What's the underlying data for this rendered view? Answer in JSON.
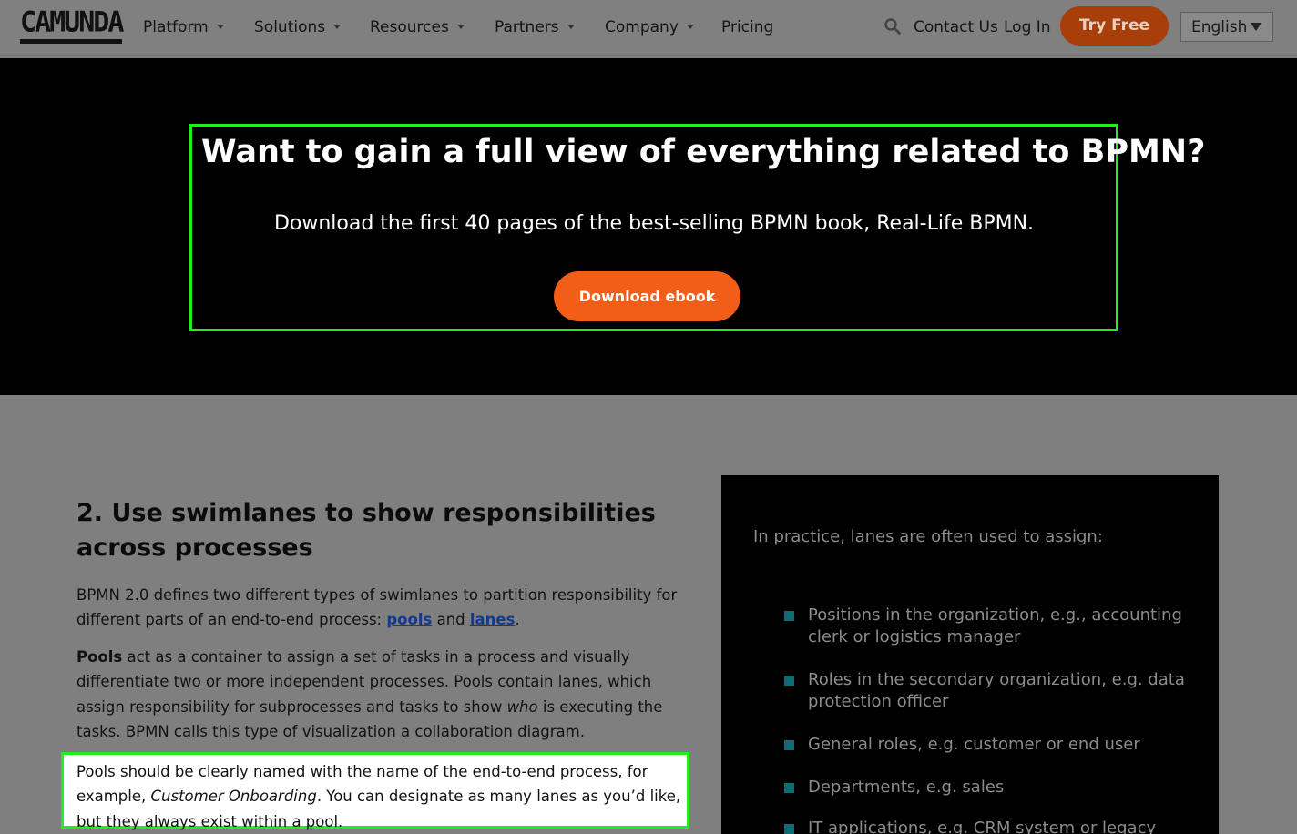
{
  "nav": {
    "logo": "CAMUNDA",
    "items": [
      {
        "label": "Platform",
        "dropdown": true
      },
      {
        "label": "Solutions",
        "dropdown": true
      },
      {
        "label": "Resources",
        "dropdown": true
      },
      {
        "label": "Partners",
        "dropdown": true
      },
      {
        "label": "Company",
        "dropdown": true
      },
      {
        "label": "Pricing",
        "dropdown": false
      }
    ],
    "contact": "Contact Us",
    "login": "Log In",
    "try_free": "Try Free",
    "language": "English"
  },
  "hero": {
    "title": "Want to gain a full view of everything related to BPMN?",
    "subtitle": "Download the first 40 pages of the best-selling BPMN book, Real-Life BPMN.",
    "button": "Download ebook"
  },
  "content": {
    "title": "2. Use swimlanes to show responsibilities across processes",
    "p1_text": "BPMN 2.0 defines two different types of swimlanes to partition responsibility for different parts of an end-to-end process: ",
    "p1_link1": "pools",
    "p1_and": " and ",
    "p1_link2": "lanes",
    "p1_end": ".",
    "p2_bold": "Pools",
    "p2_text": " act as a container to assign a set of tasks in a process and visually differentiate two or more independent processes. Pools contain lanes, which assign responsibility for subprocesses and tasks to show ",
    "p2_em": "who",
    "p2_end": " is executing the tasks. BPMN calls this type of visualization a collaboration diagram.",
    "p3_text": "Pools should be clearly named with the name of the end-to-end process, for example, ",
    "p3_em": "Customer Onboarding",
    "p3_end": ". You can designate as many lanes as you’d like, but they always exist within a pool."
  },
  "side": {
    "intro": "In practice, lanes are often used to assign:",
    "items": [
      "Positions in the organization, e.g., accounting clerk or logistics manager",
      "Roles in the secondary organization, e.g. data protection officer",
      "General roles, e.g. customer or end user",
      "Departments, e.g. sales",
      "IT applications, e.g. CRM system or legacy"
    ]
  },
  "colors": {
    "accent_orange": "#f25e17",
    "highlight_green": "#1ef01e",
    "bullet_teal": "#0c6e74"
  }
}
